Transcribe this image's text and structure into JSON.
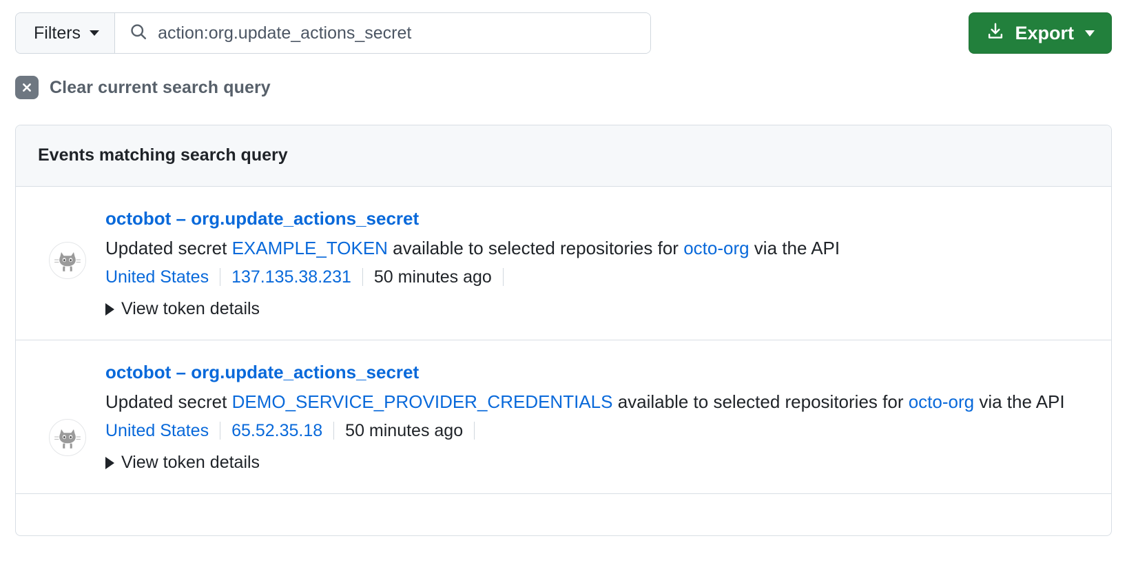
{
  "toolbar": {
    "filters_label": "Filters",
    "filters_caret_icon": "chevron-down-icon",
    "search_icon": "search-icon",
    "search_value": "action:org.update_actions_secret",
    "search_placeholder": "Search audit log",
    "export_label": "Export",
    "export_icon": "download-icon",
    "export_caret_icon": "chevron-down-icon",
    "export_color": "#22803c"
  },
  "clear_query": {
    "icon": "close-circle-icon",
    "label": "Clear current search query"
  },
  "card": {
    "header_title": "Events matching search query"
  },
  "events": [
    {
      "avatar_icon": "octocat-avatar-icon",
      "actor": "octobot",
      "dash": "–",
      "action": "org.update_actions_secret",
      "desc_prefix": "Updated secret ",
      "secret_name": "EXAMPLE_TOKEN",
      "desc_middle": " available to selected repositories for ",
      "org": "octo-org",
      "desc_suffix": " via the API",
      "country": "United States",
      "ip": "137.135.38.231",
      "time": "50 minutes ago",
      "token_details_label": "View token details",
      "token_details_icon": "triangle-right-icon"
    },
    {
      "avatar_icon": "octocat-avatar-icon",
      "actor": "octobot",
      "dash": "–",
      "action": "org.update_actions_secret",
      "desc_prefix": "Updated secret ",
      "secret_name": "DEMO_SERVICE_PROVIDER_CREDENTIALS",
      "desc_middle": " available to selected repositories for ",
      "org": "octo-org",
      "desc_suffix": " via the API",
      "country": "United States",
      "ip": "65.52.35.18",
      "time": "50 minutes ago",
      "token_details_label": "View token details",
      "token_details_icon": "triangle-right-icon"
    }
  ]
}
